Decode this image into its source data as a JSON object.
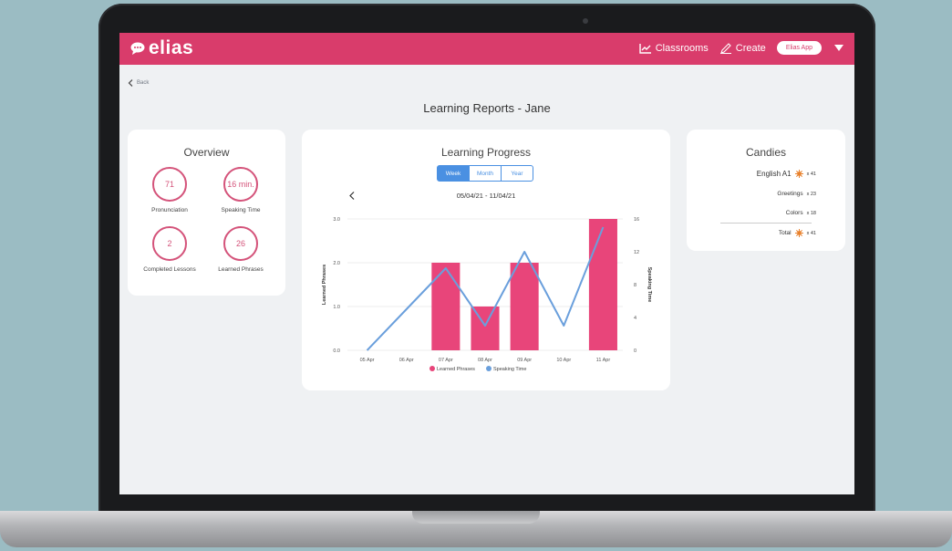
{
  "header": {
    "logo_text": "elias",
    "nav": [
      {
        "label": "Classrooms"
      },
      {
        "label": "Create"
      }
    ],
    "app_button": "Elias App"
  },
  "back_label": "Back",
  "page_title": "Learning Reports - Jane",
  "overview": {
    "title": "Overview",
    "stats": [
      {
        "value": "71",
        "label": "Pronunciation"
      },
      {
        "value": "16 min.",
        "label": "Speaking Time"
      },
      {
        "value": "2",
        "label": "Completed Lessons"
      },
      {
        "value": "26",
        "label": "Learned Phrases"
      }
    ]
  },
  "progress": {
    "title": "Learning Progress",
    "tabs": [
      {
        "label": "Week",
        "active": true
      },
      {
        "label": "Month",
        "active": false
      },
      {
        "label": "Year",
        "active": false
      }
    ],
    "range": "05/04/21 - 11/04/21"
  },
  "chart_data": {
    "type": "bar",
    "categories": [
      "05 Apr",
      "06 Apr",
      "07 Apr",
      "08 Apr",
      "09 Apr",
      "10 Apr",
      "11 Apr"
    ],
    "series": [
      {
        "name": "Learned Phrases",
        "type": "bar",
        "axis": "left",
        "color": "#e8457a",
        "values": [
          0,
          0,
          2,
          1,
          2,
          0,
          3
        ]
      },
      {
        "name": "Speaking Time",
        "type": "line",
        "axis": "right",
        "color": "#6a9fdc",
        "values": [
          0,
          5,
          10,
          3,
          12,
          3,
          15
        ]
      }
    ],
    "ylabel": "Learned Phrases",
    "y2label": "Speaking Time",
    "ylim": [
      0,
      3
    ],
    "y2lim": [
      0,
      16
    ],
    "yticks": [
      "0.0",
      "1.0",
      "2.0",
      "3.0"
    ],
    "y2ticks": [
      "0",
      "4",
      "8",
      "12",
      "16"
    ],
    "y2tick_values": [
      0,
      4,
      8,
      12,
      16
    ],
    "ytick_values": [
      0,
      1,
      2,
      3
    ],
    "legend_position": "bottom",
    "grid": true
  },
  "candies": {
    "title": "Candies",
    "course": {
      "name": "English A1",
      "count": "x 41"
    },
    "items": [
      {
        "name": "Greetings",
        "count": "x 23"
      },
      {
        "name": "Colors",
        "count": "x 18"
      }
    ],
    "total": {
      "label": "Total",
      "count": "x 41"
    }
  },
  "colors": {
    "brand": "#d93c6b",
    "ring": "#d4537a",
    "accent_blue": "#4a90e2",
    "candy": "#e8812c"
  }
}
